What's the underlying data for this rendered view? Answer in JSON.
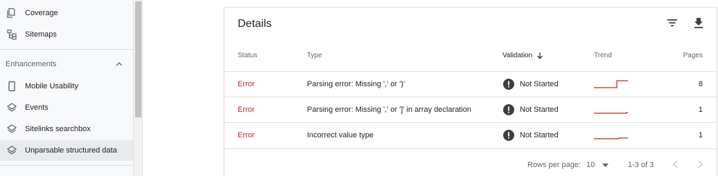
{
  "sidebar": {
    "items_top": [
      {
        "label": "Coverage",
        "icon": "copy-pages-icon"
      },
      {
        "label": "Sitemaps",
        "icon": "sitemap-tree-icon"
      }
    ],
    "section": {
      "label": "Enhancements",
      "expanded": true
    },
    "items_enh": [
      {
        "label": "Mobile Usability",
        "icon": "phone-icon"
      },
      {
        "label": "Events",
        "icon": "layers-icon"
      },
      {
        "label": "Sitelinks searchbox",
        "icon": "layers-icon"
      },
      {
        "label": "Unparsable structured data",
        "icon": "layers-icon",
        "active": true
      }
    ]
  },
  "details": {
    "title": "Details",
    "columns": {
      "status": "Status",
      "type": "Type",
      "validation": "Validation",
      "trend": "Trend",
      "pages": "Pages"
    },
    "rows": [
      {
        "status": "Error",
        "type": "Parsing error: Missing ',' or ')'",
        "validation": "Not Started",
        "pages": "8"
      },
      {
        "status": "Error",
        "type": "Parsing error: Missing ',' or ']' in array declaration",
        "validation": "Not Started",
        "pages": "1"
      },
      {
        "status": "Error",
        "type": "Incorrect value type",
        "validation": "Not Started",
        "pages": "1"
      }
    ],
    "footer": {
      "rows_per_page_label": "Rows per page:",
      "rows_per_page_value": "10",
      "range": "1-3 of 3"
    }
  },
  "colors": {
    "error": "#c5221f",
    "trend_line": "#c5221f",
    "sidebar_bg": "#f8f9fa",
    "active_bg": "#e8eaed"
  }
}
